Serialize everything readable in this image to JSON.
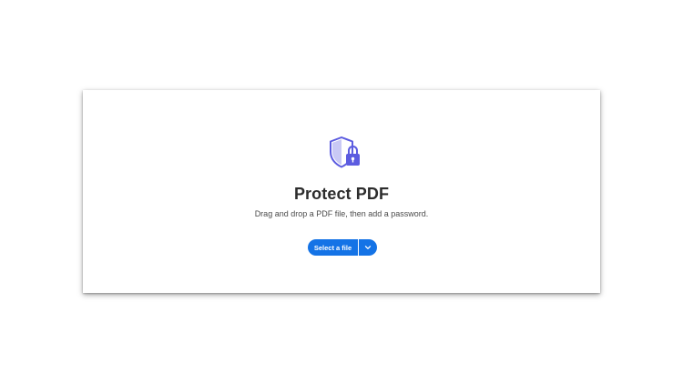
{
  "tool": {
    "title": "Protect PDF",
    "description": "Drag and drop a PDF file, then add a password.",
    "select_button_label": "Select a file",
    "icon": "shield-lock-icon",
    "dropdown_icon": "chevron-down-icon"
  },
  "colors": {
    "accent": "#1473e6",
    "icon_primary": "#5c5ce0",
    "title": "#2c2c2c",
    "text": "#4b4b4b"
  }
}
